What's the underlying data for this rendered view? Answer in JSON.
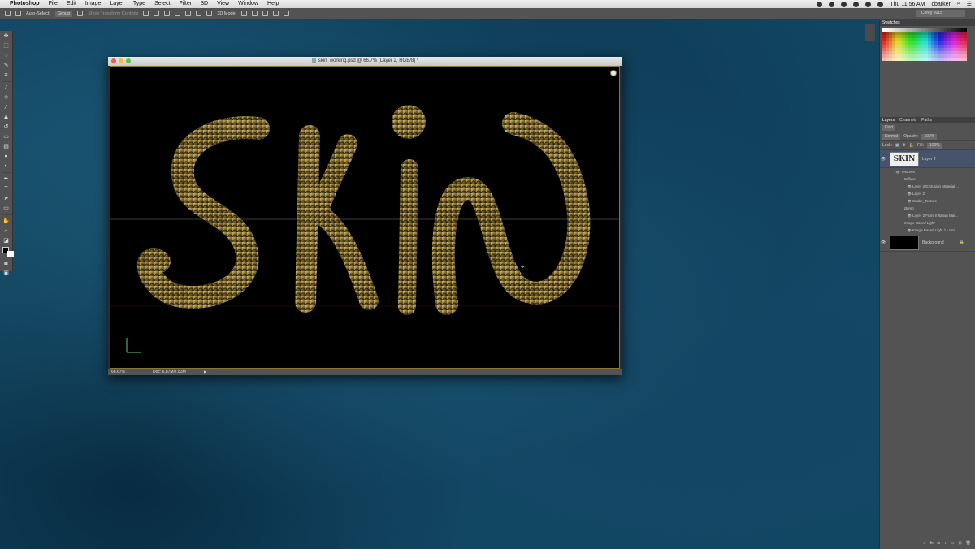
{
  "menubar": {
    "app_name": "Photoshop",
    "menus": [
      "File",
      "Edit",
      "Image",
      "Layer",
      "Type",
      "Select",
      "Filter",
      "3D",
      "View",
      "Window",
      "Help"
    ],
    "clock": "Thu 11:56 AM",
    "user": "cbarker"
  },
  "options": {
    "auto_select": "Auto-Select:",
    "group": "Group",
    "show_transform": "Show Transform Controls",
    "mode3d": "3D Mode:",
    "workspace": "Corey 2015"
  },
  "document": {
    "title": "skin_working.psd @ 66.7% (Layer 2, RGB/8) *",
    "zoom": "66.67%",
    "doc_size": "Doc: 6.87M/7.83M"
  },
  "artwork_text": "SKIN",
  "panels": {
    "swatches_tab": "Swatches",
    "layers_tab": "Layers",
    "channels_tab": "Channels",
    "paths_tab": "Paths",
    "kind": "Kind",
    "blend_mode": "Normal",
    "opacity_label": "Opacity:",
    "opacity_value": "100%",
    "lock_label": "Lock:",
    "fill_label": "Fill:",
    "fill_value": "100%"
  },
  "layers": {
    "layer2": "Layer 2",
    "textures": "Textures",
    "diffuse": "Diffuse",
    "extrusion": "Layer 2 Extrusion Material ...",
    "layer2_sub": "Layer 2",
    "snake": "Snake_Texture",
    "bump": "Bump",
    "front_inflation": "Layer 2 Front Inflation Mat...",
    "ibl": "Image Based Light",
    "ibl_item": "Image Based Light 1 - Ima...",
    "background": "Background"
  }
}
